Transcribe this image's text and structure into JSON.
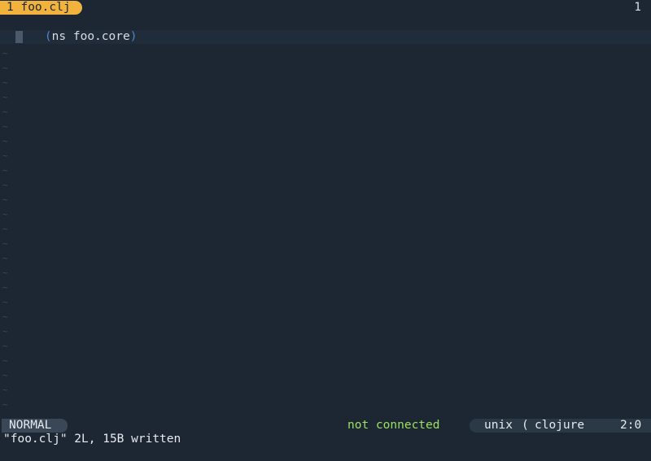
{
  "tabline": {
    "tab_label": "1 foo.clj",
    "tab_count": "1"
  },
  "buffer": {
    "line1": {
      "open_paren": "(",
      "keyword": "ns",
      "namespace": " foo.core",
      "close_paren": ")"
    },
    "empty_line_marker": "~",
    "empty_line_count": 25
  },
  "statusline": {
    "mode": "NORMAL",
    "lsp_status": "not connected",
    "fileformat": "unix",
    "filetype_separator": "(",
    "filetype": "clojure",
    "position": "2:0"
  },
  "cmdline": {
    "message": "\"foo.clj\" 2L, 15B written"
  },
  "colors": {
    "background": "#1d2733",
    "tab_active": "#f2b33d",
    "lsp_status": "#9be25e",
    "paren": "#4f86c6",
    "tilde": "#3c4a59"
  }
}
